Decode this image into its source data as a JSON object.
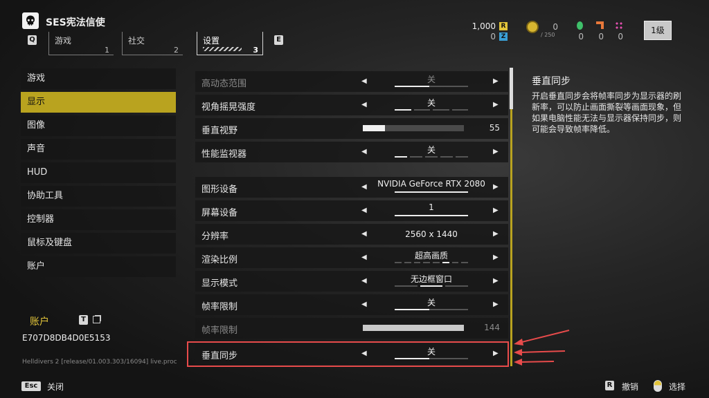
{
  "header": {
    "title": "SES宪法信使",
    "tab_key_left": "Q",
    "tab_key_right": "E",
    "tabs": [
      {
        "label": "游戏",
        "num": "1"
      },
      {
        "label": "社交",
        "num": "2"
      },
      {
        "label": "设置",
        "num": "3"
      }
    ]
  },
  "currency": {
    "r_value": "1,000",
    "r_badge": "R",
    "z_value": "0",
    "z_badge": "Z",
    "medal_value": "0",
    "medal_max": "/ 250",
    "green": "0",
    "orange": "0",
    "pink": "0",
    "level": "1级"
  },
  "sidebar": {
    "items": [
      {
        "label": "游戏"
      },
      {
        "label": "显示"
      },
      {
        "label": "图像"
      },
      {
        "label": "声音"
      },
      {
        "label": "HUD"
      },
      {
        "label": "协助工具"
      },
      {
        "label": "控制器"
      },
      {
        "label": "鼠标及键盘"
      },
      {
        "label": "账户"
      }
    ],
    "account_title": "账户",
    "account_key": "T",
    "account_id": "E707D8DB4D0E5153",
    "version": "Helldivers 2 [release/01.003.303/16094] live.proc"
  },
  "settings": [
    {
      "label": "高动态范围",
      "value": "关"
    },
    {
      "label": "视角摇晃强度",
      "value": "关"
    },
    {
      "label": "垂直视野",
      "value": "55",
      "fraction": 0.22
    },
    {
      "label": "性能监视器",
      "value": "关"
    },
    {
      "label": "图形设备",
      "value": "NVIDIA GeForce RTX 2080"
    },
    {
      "label": "屏幕设备",
      "value": "1"
    },
    {
      "label": "分辨率",
      "value": "2560 x 1440"
    },
    {
      "label": "渲染比例",
      "value": "超高画质"
    },
    {
      "label": "显示模式",
      "value": "无边框窗口"
    },
    {
      "label": "帧率限制",
      "value": "关"
    },
    {
      "label": "帧率限制",
      "value": "144",
      "fraction": 1.0
    },
    {
      "label": "垂直同步",
      "value": "关"
    }
  ],
  "info": {
    "title": "垂直同步",
    "body": "开启垂直同步会将帧率同步为显示器的刷新率，可以防止画面撕裂等画面现象，但如果电脑性能无法与显示器保持同步，则可能会导致帧率降低。"
  },
  "footer": {
    "esc_key": "Esc",
    "close_label": "关闭",
    "r_key": "R",
    "cancel_label": "撤销",
    "select_label": "选择"
  },
  "colors": {
    "accent_yellow": "#b9a31f",
    "annotation_red": "#e84b4b"
  }
}
